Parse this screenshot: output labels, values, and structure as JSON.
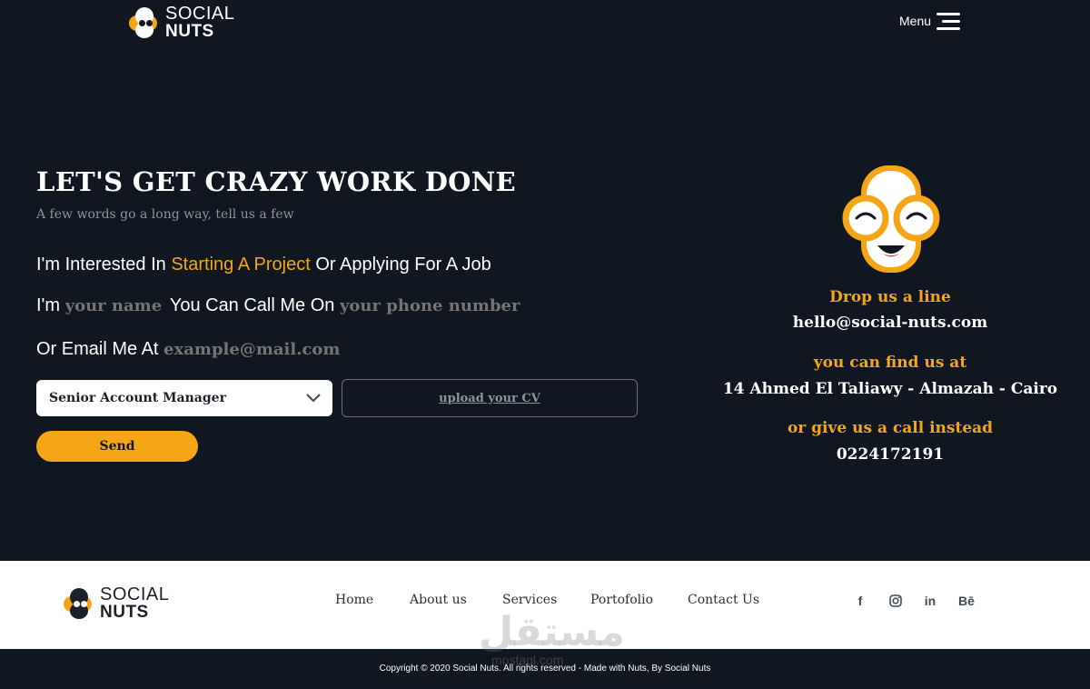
{
  "header": {
    "logo_line1": "SOCIAL",
    "logo_line2": "NUTS",
    "menu_label": "Menu"
  },
  "form": {
    "headline": "LET'S GET CRAZY WORK DONE",
    "subline": "A few words go a long way, tell us a few",
    "line1_prefix": "I'm Interested In",
    "line1_accent": "Starting A Project",
    "line1_suffix": "Or Applying For A Job",
    "line2_prefix": "I'm",
    "name_placeholder": "your name",
    "line2_middle": "You Can Call Me On",
    "phone_placeholder": "your phone number",
    "line3_prefix": "Or Email Me At",
    "email_placeholder": "example@mail.com",
    "position_selected": "Senior Account Manager",
    "upload_label": "upload your CV",
    "send_label": "Send"
  },
  "contact": {
    "drop_label": "Drop us a line",
    "email": "hello@social-nuts.com",
    "find_label": "you can find us at",
    "address": "14 Ahmed El Taliawy - Almazah - Cairo",
    "call_label": "or give us a call instead",
    "phone": "0224172191"
  },
  "footer": {
    "logo_line1": "SOCIAL",
    "logo_line2": "NUTS",
    "nav": [
      "Home",
      "About us",
      "Services",
      "Portofolio",
      "Contact Us"
    ],
    "social_icons": [
      "facebook-icon",
      "instagram-icon",
      "linkedin-icon",
      "behance-icon"
    ],
    "behance_glyph": "Bē",
    "facebook_glyph": "f",
    "linkedin_glyph": "in",
    "copyright": "Copyright © 2020 Social Nuts. All rights reserved - Made with Nuts, By Social Nuts"
  },
  "watermark": {
    "arabic": "مستقل",
    "latin": "mostaql.com"
  },
  "colors": {
    "background": "#111720",
    "accent": "#f5a516",
    "footer_bg": "#ffffff"
  }
}
